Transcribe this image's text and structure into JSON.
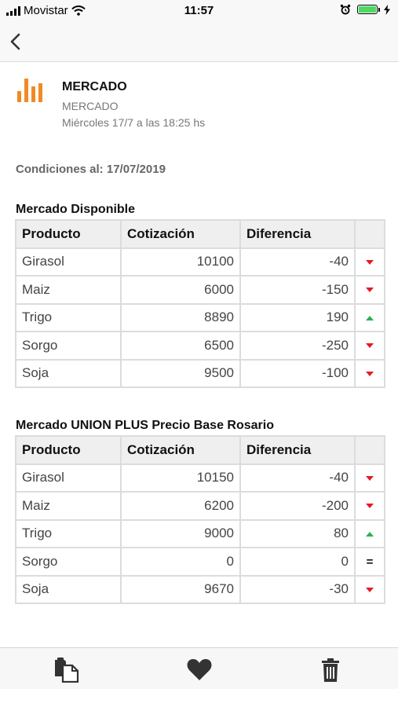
{
  "status": {
    "carrier": "Movistar",
    "time": "11:57"
  },
  "nav": {
    "back_icon": "chevron-left-icon"
  },
  "header": {
    "title": "MERCADO",
    "subtitle": "MERCADO",
    "date": "Miércoles 17/7 a las 18:25 hs"
  },
  "conditions": "Condiciones al: 17/07/2019",
  "colors": {
    "down": "#e51c23",
    "up": "#2bb24c",
    "logo": "#f08a24"
  },
  "tables": [
    {
      "title": "Mercado Disponible",
      "headers": [
        "Producto",
        "Cotización",
        "Diferencia"
      ],
      "rows": [
        {
          "producto": "Girasol",
          "cotizacion": "10100",
          "diferencia": "-40",
          "trend": "down"
        },
        {
          "producto": "Maiz",
          "cotizacion": "6000",
          "diferencia": "-150",
          "trend": "down"
        },
        {
          "producto": "Trigo",
          "cotizacion": "8890",
          "diferencia": "190",
          "trend": "up"
        },
        {
          "producto": "Sorgo",
          "cotizacion": "6500",
          "diferencia": "-250",
          "trend": "down"
        },
        {
          "producto": "Soja",
          "cotizacion": "9500",
          "diferencia": "-100",
          "trend": "down"
        }
      ]
    },
    {
      "title": "Mercado UNION PLUS Precio Base Rosario",
      "headers": [
        "Producto",
        "Cotización",
        "Diferencia"
      ],
      "rows": [
        {
          "producto": "Girasol",
          "cotizacion": "10150",
          "diferencia": "-40",
          "trend": "down"
        },
        {
          "producto": "Maiz",
          "cotizacion": "6200",
          "diferencia": "-200",
          "trend": "down"
        },
        {
          "producto": "Trigo",
          "cotizacion": "9000",
          "diferencia": "80",
          "trend": "up"
        },
        {
          "producto": "Sorgo",
          "cotizacion": "0",
          "diferencia": "0",
          "trend": "equal",
          "equal_symbol": "="
        },
        {
          "producto": "Soja",
          "cotizacion": "9670",
          "diferencia": "-30",
          "trend": "down"
        }
      ]
    }
  ],
  "toolbar": {
    "icons": [
      "copy-icon",
      "heart-icon",
      "trash-icon"
    ]
  }
}
